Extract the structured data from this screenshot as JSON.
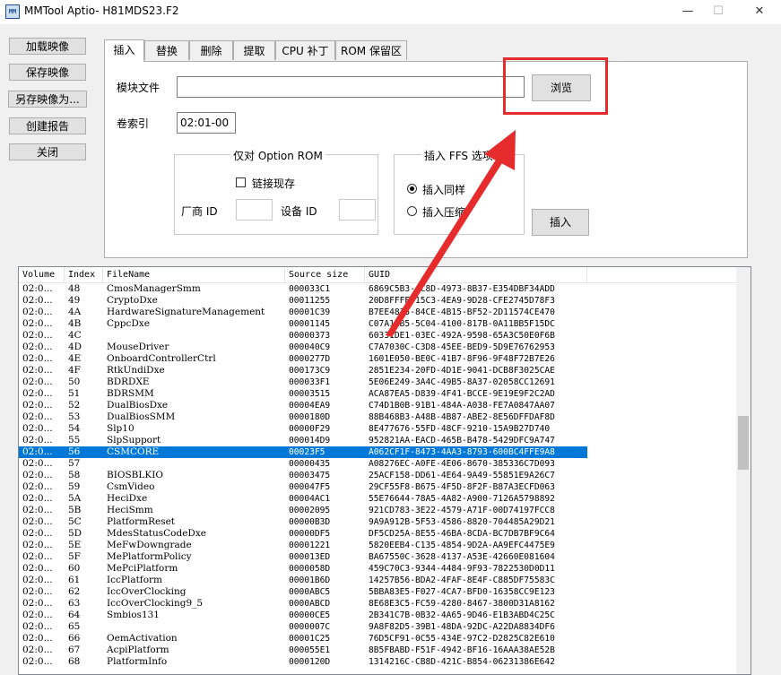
{
  "window": {
    "app_icon_text": "MM",
    "title": "MMTool Aptio- H81MDS23.F2",
    "minimize": "—",
    "maximize": "☐",
    "close": "✕"
  },
  "left_buttons": {
    "load": "加载映像",
    "save": "保存映像",
    "save_as": "另存映像为...",
    "report": "创建报告",
    "close": "关闭"
  },
  "tabs": [
    "插入",
    "替换",
    "删除",
    "提取",
    "CPU 补丁",
    "ROM 保留区"
  ],
  "insert_panel": {
    "module_file_label": "模块文件",
    "module_file_value": "",
    "browse_button": "浏览",
    "volume_index_label": "卷索引",
    "volume_index_value": "02:01-00",
    "option_rom_group": "仅对 Option ROM",
    "link_existing": "链接现存",
    "vendor_id_label": "厂商 ID",
    "device_id_label": "设备 ID",
    "ffs_group": "插入 FFS 选项",
    "insert_as_is": "插入同样",
    "insert_compressed": "插入压缩",
    "insert_button": "插入"
  },
  "table": {
    "columns": [
      "Volume",
      "Index",
      "FileName",
      "Source size",
      "GUID"
    ],
    "rows": [
      [
        "02:0...",
        "48",
        "CmosManagerSmm",
        "000033C1",
        "6869C5B3-AC8D-4973-8B37-E354DBF34ADD"
      ],
      [
        "02:0...",
        "49",
        "CryptoDxe",
        "00011255",
        "20D8FFFE-15C3-4EA9-9D28-CFE2745D78F3"
      ],
      [
        "02:0...",
        "4A",
        "HardwareSignatureManagement",
        "00001C39",
        "B7EE4835-84CE-4B15-BF52-2D11574CE470"
      ],
      [
        "02:0...",
        "4B",
        "CppcDxe",
        "00001145",
        "C07A1EB5-5C04-4100-817B-0A11BB5F15DC"
      ],
      [
        "02:0...",
        "4C",
        "",
        "00000373",
        "60331DE1-03EC-492A-9598-65A3C50E0F6B"
      ],
      [
        "02:0...",
        "4D",
        "MouseDriver",
        "000040C9",
        "C7A7030C-C3D8-45EE-BED9-5D9E76762953"
      ],
      [
        "02:0...",
        "4E",
        "OnboardControllerCtrl",
        "0000277D",
        "1601E050-BE0C-41B7-8F96-9F48F72B7E26"
      ],
      [
        "02:0...",
        "4F",
        "RtkUndiDxe",
        "000173C9",
        "2851E234-20FD-4D1E-9041-DCB8F3025CAE"
      ],
      [
        "02:0...",
        "50",
        "BDRDXE",
        "000033F1",
        "5E06E249-3A4C-49B5-8A37-02058CC12691"
      ],
      [
        "02:0...",
        "51",
        "BDRSMM",
        "00003515",
        "ACA87EA5-D839-4F41-BCCE-9E19E9F2C2AD"
      ],
      [
        "02:0...",
        "52",
        "DualBiosDxe",
        "00004EA9",
        "C74D1B0B-91B1-484A-A038-FE7A0847AA07"
      ],
      [
        "02:0...",
        "53",
        "DualBiosSMM",
        "0000180D",
        "88B468B3-A48B-4B87-ABE2-8E56DFFDAF8D"
      ],
      [
        "02:0...",
        "54",
        "Slp10",
        "00000F29",
        "8E477676-55FD-48CF-9210-15A9B27D740"
      ],
      [
        "02:0...",
        "55",
        "SlpSupport",
        "000014D9",
        "952821AA-EACD-465B-B478-5429DFC9A747"
      ],
      [
        "02:0...",
        "56",
        "CSMCORE",
        "00023F5",
        "A062CF1F-8473-4AA3-8793-600BC4FFE9A8"
      ],
      [
        "02:0...",
        "57",
        "",
        "00000435",
        "A08276EC-A0FE-4E06-8670-385336C7D093"
      ],
      [
        "02:0...",
        "58",
        "BIOSBLKIO",
        "00003475",
        "25ACF158-DD61-4E64-9A49-55851E9A26C7"
      ],
      [
        "02:0...",
        "59",
        "CsmVideo",
        "000047F5",
        "29CF55F8-B675-4F5D-8F2F-B87A3ECFD063"
      ],
      [
        "02:0...",
        "5A",
        "HeciDxe",
        "00004AC1",
        "55E76644-78A5-4A82-A900-7126A5798892"
      ],
      [
        "02:0...",
        "5B",
        "HeciSmm",
        "00002095",
        "921CD783-3E22-4579-A71F-00D74197FCC8"
      ],
      [
        "02:0...",
        "5C",
        "PlatformReset",
        "00000B3D",
        "9A9A912B-5F53-4586-8820-704485A29D21"
      ],
      [
        "02:0...",
        "5D",
        "MdesStatusCodeDxe",
        "00000DF5",
        "DF5CD25A-8E55-46BA-8CDA-BC7DB7BF9C64"
      ],
      [
        "02:0...",
        "5E",
        "MeFwDowngrade",
        "00001221",
        "5820EEB4-C135-4854-9D2A-AA9EFC4475E9"
      ],
      [
        "02:0...",
        "5F",
        "MePlatformPolicy",
        "000013ED",
        "BA67550C-3628-4137-A53E-42660E081604"
      ],
      [
        "02:0...",
        "60",
        "MePciPlatform",
        "0000058D",
        "459C70C3-9344-4484-9F93-7822530D0D11"
      ],
      [
        "02:0...",
        "61",
        "IccPlatform",
        "00001B6D",
        "14257B56-BDA2-4FAF-8E4F-C885DF75583C"
      ],
      [
        "02:0...",
        "62",
        "IccOverClocking",
        "0000ABC5",
        "5BBA83E5-F027-4CA7-BFD0-16358CC9E123"
      ],
      [
        "02:0...",
        "63",
        "IccOverClocking9_5",
        "0000ABCD",
        "8E68E3C5-FC59-4280-8467-3800D31A8162"
      ],
      [
        "02:0...",
        "64",
        "Smbios131",
        "00000CE5",
        "2B341C7B-0B32-4A65-9D46-E1B3ABD4C25C"
      ],
      [
        "02:0...",
        "65",
        "",
        "0000007C",
        "9A8F82D5-39B1-48DA-92DC-A22DA8834DF6"
      ],
      [
        "02:0...",
        "66",
        "OemActivation",
        "00001C25",
        "76D5CF91-0C55-434E-97C2-D2825C82E610"
      ],
      [
        "02:0...",
        "67",
        "AcpiPlatform",
        "000055E1",
        "8B5FBABD-F51F-4942-BF16-16AAA38AE52B"
      ],
      [
        "02:0...",
        "68",
        "PlatformInfo",
        "0000120D",
        "1314216C-CB8D-421C-B854-06231386E642"
      ]
    ],
    "selected_index": 14
  },
  "annotation": {
    "highlight_color": "#e52b2b"
  }
}
